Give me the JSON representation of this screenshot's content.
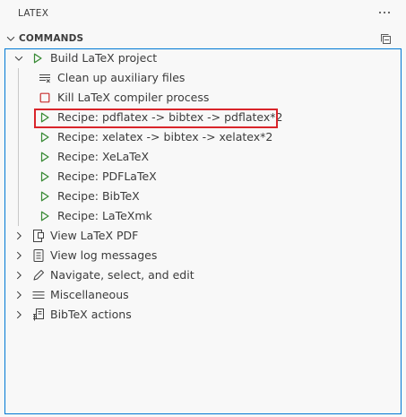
{
  "view": {
    "title": "LATEX",
    "more_icon": "ellipsis-icon"
  },
  "section": {
    "title": "COMMANDS",
    "collapse_icon": "collapse-all-icon"
  },
  "tree": {
    "build": {
      "label": "Build LaTeX project",
      "icon": "play-icon",
      "expanded": true,
      "children": [
        {
          "label": "Clean up auxiliary files",
          "icon": "clear-all-icon"
        },
        {
          "label": "Kill LaTeX compiler process",
          "icon": "stop-icon"
        },
        {
          "label": "Recipe: pdflatex -> bibtex -> pdflatex*2",
          "icon": "play-icon"
        },
        {
          "label": "Recipe: xelatex -> bibtex -> xelatex*2",
          "icon": "play-icon"
        },
        {
          "label": "Recipe: XeLaTeX",
          "icon": "play-icon"
        },
        {
          "label": "Recipe: PDFLaTeX",
          "icon": "play-icon"
        },
        {
          "label": "Recipe: BibTeX",
          "icon": "play-icon"
        },
        {
          "label": "Recipe: LaTeXmk",
          "icon": "play-icon"
        }
      ]
    },
    "items": [
      {
        "label": "View LaTeX PDF",
        "icon": "open-preview-icon"
      },
      {
        "label": "View log messages",
        "icon": "output-log-icon"
      },
      {
        "label": "Navigate, select, and edit",
        "icon": "edit-pencil-icon"
      },
      {
        "label": "Miscellaneous",
        "icon": "menu-lines-icon"
      },
      {
        "label": "BibTeX actions",
        "icon": "bibtex-icon"
      }
    ]
  },
  "colors": {
    "play_icon": "#388a34",
    "stop_icon": "#c72e2e",
    "focus_border": "#0078d4",
    "highlight_box": "#d9252b"
  }
}
